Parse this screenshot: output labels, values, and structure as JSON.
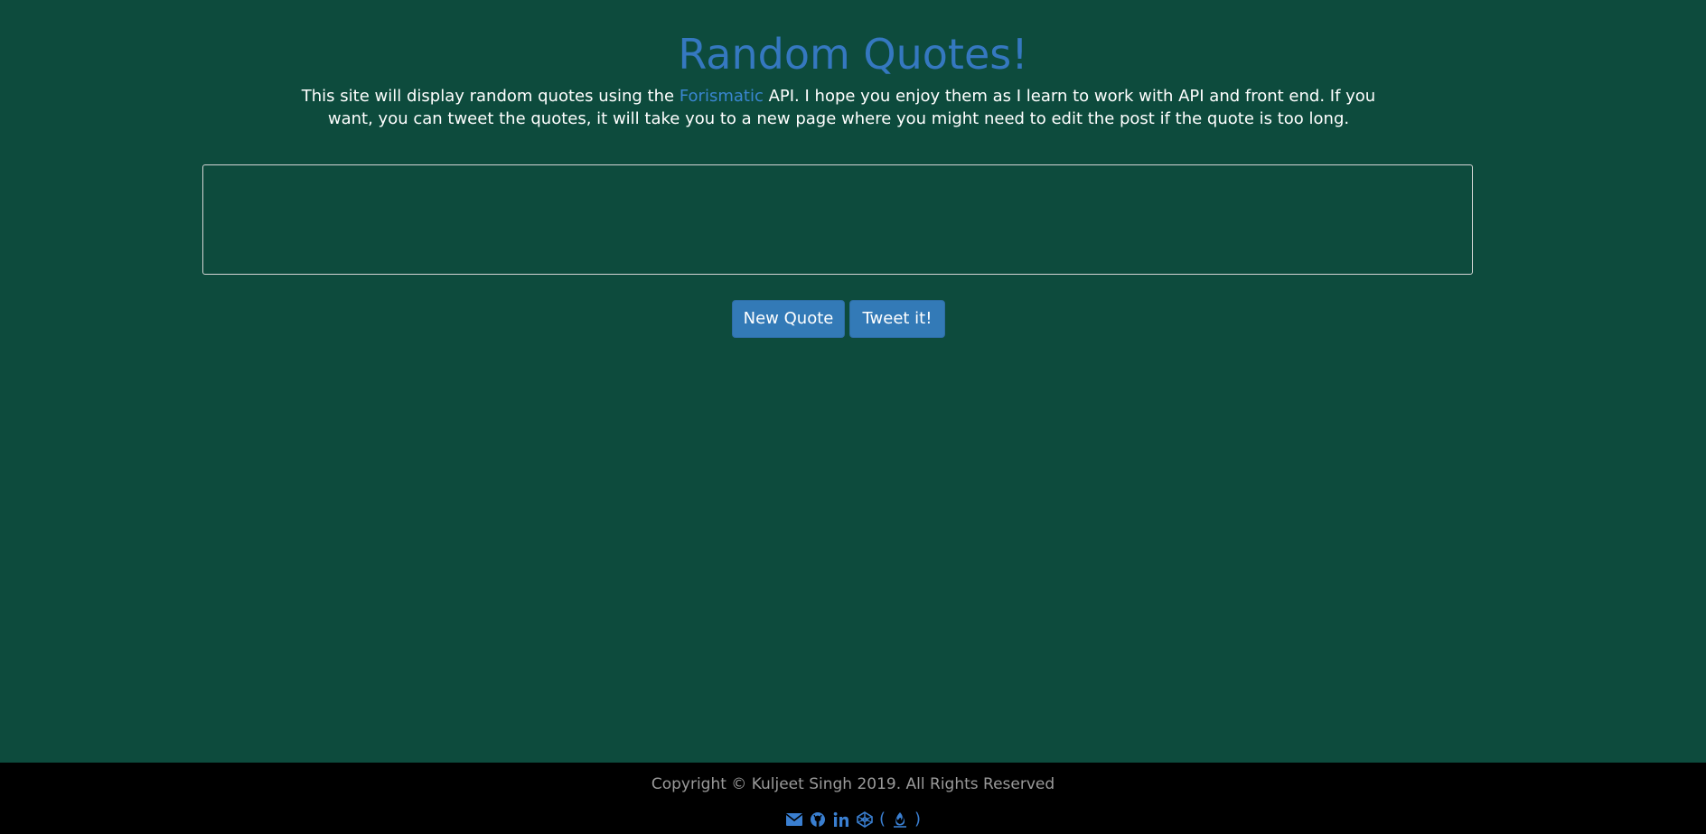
{
  "header": {
    "title": "Random Quotes!",
    "intro_before": "This site will display random quotes using the ",
    "intro_link": "Forismatic",
    "intro_after": " API. I hope you enjoy them as I learn to work with API and front end. If you want, you can tweet the quotes, it will take you to a new page where you might need to edit the post if the quote is too long."
  },
  "quote": {
    "text": ""
  },
  "buttons": {
    "new_quote": "New Quote",
    "tweet": "Tweet it!"
  },
  "footer": {
    "copyright": "Copyright © Kuljeet Singh 2019. All Rights Reserved",
    "icons": [
      "envelope-icon",
      "github-icon",
      "linkedin-icon",
      "codepen-icon",
      "freecodecamp-icon"
    ],
    "paren_open": "(",
    "paren_close": ")"
  },
  "colors": {
    "background": "#0d4b3d",
    "accent": "#337ab7",
    "footer_bg": "#000000"
  }
}
